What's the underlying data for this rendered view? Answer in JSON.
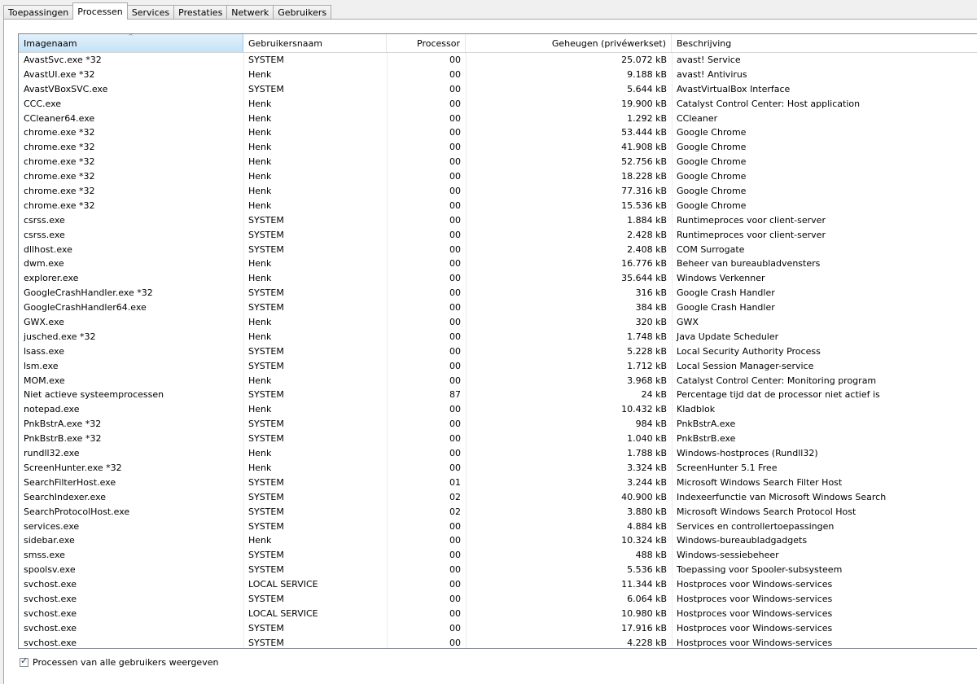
{
  "tabs": [
    {
      "label": "Toepassingen",
      "active": false
    },
    {
      "label": "Processen",
      "active": true
    },
    {
      "label": "Services",
      "active": false
    },
    {
      "label": "Prestaties",
      "active": false
    },
    {
      "label": "Netwerk",
      "active": false
    },
    {
      "label": "Gebruikers",
      "active": false
    }
  ],
  "columns": [
    {
      "label": "Imagenaam",
      "sorted": true
    },
    {
      "label": "Gebruikersnaam",
      "sorted": false
    },
    {
      "label": "Processor",
      "sorted": false
    },
    {
      "label": "Geheugen (privéwerkset)",
      "sorted": false
    },
    {
      "label": "Beschrijving",
      "sorted": false
    }
  ],
  "sort_indicator": "^",
  "processes": [
    [
      "AvastSvc.exe *32",
      "SYSTEM",
      "00",
      "25.072 kB",
      "avast! Service"
    ],
    [
      "AvastUI.exe *32",
      "Henk",
      "00",
      "9.188 kB",
      "avast! Antivirus"
    ],
    [
      "AvastVBoxSVC.exe",
      "SYSTEM",
      "00",
      "5.644 kB",
      "AvastVirtualBox Interface"
    ],
    [
      "CCC.exe",
      "Henk",
      "00",
      "19.900 kB",
      "Catalyst Control Center: Host application"
    ],
    [
      "CCleaner64.exe",
      "Henk",
      "00",
      "1.292 kB",
      "CCleaner"
    ],
    [
      "chrome.exe *32",
      "Henk",
      "00",
      "53.444 kB",
      "Google Chrome"
    ],
    [
      "chrome.exe *32",
      "Henk",
      "00",
      "41.908 kB",
      "Google Chrome"
    ],
    [
      "chrome.exe *32",
      "Henk",
      "00",
      "52.756 kB",
      "Google Chrome"
    ],
    [
      "chrome.exe *32",
      "Henk",
      "00",
      "18.228 kB",
      "Google Chrome"
    ],
    [
      "chrome.exe *32",
      "Henk",
      "00",
      "77.316 kB",
      "Google Chrome"
    ],
    [
      "chrome.exe *32",
      "Henk",
      "00",
      "15.536 kB",
      "Google Chrome"
    ],
    [
      "csrss.exe",
      "SYSTEM",
      "00",
      "1.884 kB",
      "Runtimeproces voor client-server"
    ],
    [
      "csrss.exe",
      "SYSTEM",
      "00",
      "2.428 kB",
      "Runtimeproces voor client-server"
    ],
    [
      "dllhost.exe",
      "SYSTEM",
      "00",
      "2.408 kB",
      "COM Surrogate"
    ],
    [
      "dwm.exe",
      "Henk",
      "00",
      "16.776 kB",
      "Beheer van bureaubladvensters"
    ],
    [
      "explorer.exe",
      "Henk",
      "00",
      "35.644 kB",
      "Windows Verkenner"
    ],
    [
      "GoogleCrashHandler.exe *32",
      "SYSTEM",
      "00",
      "316 kB",
      "Google Crash Handler"
    ],
    [
      "GoogleCrashHandler64.exe",
      "SYSTEM",
      "00",
      "384 kB",
      "Google Crash Handler"
    ],
    [
      "GWX.exe",
      "Henk",
      "00",
      "320 kB",
      "GWX"
    ],
    [
      "jusched.exe *32",
      "Henk",
      "00",
      "1.748 kB",
      "Java Update Scheduler"
    ],
    [
      "lsass.exe",
      "SYSTEM",
      "00",
      "5.228 kB",
      "Local Security Authority Process"
    ],
    [
      "lsm.exe",
      "SYSTEM",
      "00",
      "1.712 kB",
      "Local Session Manager-service"
    ],
    [
      "MOM.exe",
      "Henk",
      "00",
      "3.968 kB",
      "Catalyst Control Center: Monitoring program"
    ],
    [
      "Niet actieve systeemprocessen",
      "SYSTEM",
      "87",
      "24 kB",
      "Percentage tijd dat de processor niet actief is"
    ],
    [
      "notepad.exe",
      "Henk",
      "00",
      "10.432 kB",
      "Kladblok"
    ],
    [
      "PnkBstrA.exe *32",
      "SYSTEM",
      "00",
      "984 kB",
      "PnkBstrA.exe"
    ],
    [
      "PnkBstrB.exe *32",
      "SYSTEM",
      "00",
      "1.040 kB",
      "PnkBstrB.exe"
    ],
    [
      "rundll32.exe",
      "Henk",
      "00",
      "1.788 kB",
      "Windows-hostproces (Rundll32)"
    ],
    [
      "ScreenHunter.exe *32",
      "Henk",
      "00",
      "3.324 kB",
      "ScreenHunter 5.1 Free"
    ],
    [
      "SearchFilterHost.exe",
      "SYSTEM",
      "01",
      "3.244 kB",
      "Microsoft Windows Search Filter Host"
    ],
    [
      "SearchIndexer.exe",
      "SYSTEM",
      "02",
      "40.900 kB",
      "Indexeerfunctie van Microsoft Windows Search"
    ],
    [
      "SearchProtocolHost.exe",
      "SYSTEM",
      "02",
      "3.880 kB",
      "Microsoft Windows Search Protocol Host"
    ],
    [
      "services.exe",
      "SYSTEM",
      "00",
      "4.884 kB",
      "Services en controllertoepassingen"
    ],
    [
      "sidebar.exe",
      "Henk",
      "00",
      "10.324 kB",
      "Windows-bureaubladgadgets"
    ],
    [
      "smss.exe",
      "SYSTEM",
      "00",
      "488 kB",
      "Windows-sessiebeheer"
    ],
    [
      "spoolsv.exe",
      "SYSTEM",
      "00",
      "5.536 kB",
      "Toepassing voor Spooler-subsysteem"
    ],
    [
      "svchost.exe",
      "LOCAL SERVICE",
      "00",
      "11.344 kB",
      "Hostproces voor Windows-services"
    ],
    [
      "svchost.exe",
      "SYSTEM",
      "00",
      "6.064 kB",
      "Hostproces voor Windows-services"
    ],
    [
      "svchost.exe",
      "LOCAL SERVICE",
      "00",
      "10.980 kB",
      "Hostproces voor Windows-services"
    ],
    [
      "svchost.exe",
      "SYSTEM",
      "00",
      "17.916 kB",
      "Hostproces voor Windows-services"
    ],
    [
      "svchost.exe",
      "SYSTEM",
      "00",
      "4.228 kB",
      "Hostproces voor Windows-services"
    ]
  ],
  "show_all_users": {
    "label": "Processen van alle gebruikers weergeven",
    "checked": true,
    "check_glyph": "✓"
  },
  "colors": {
    "sorted_header": "#c4e2f6",
    "list_border": "#828790",
    "window_bg": "#f0f0f0"
  }
}
